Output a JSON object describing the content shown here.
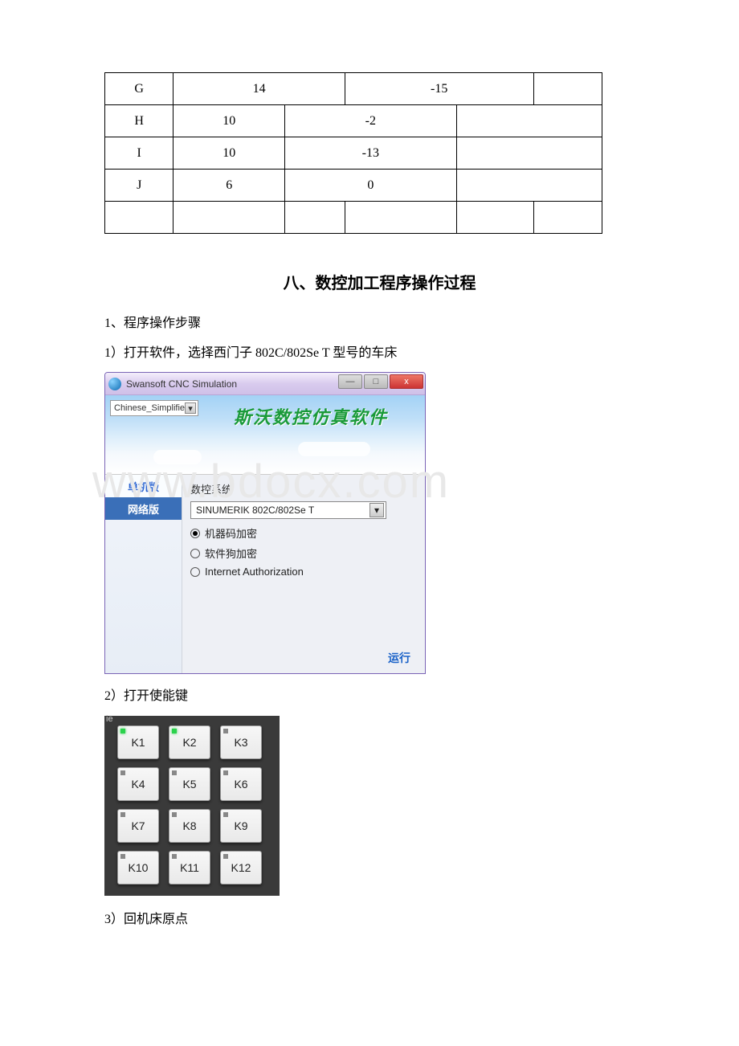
{
  "table": {
    "rows": [
      {
        "c1": "G",
        "c2": "",
        "c3": "14",
        "c4": "",
        "c5": "-15",
        "c6": ""
      },
      {
        "c1": "H",
        "c2": "10",
        "c3": "",
        "c4": "-2",
        "c5": "",
        "c6": ""
      },
      {
        "c1": "I",
        "c2": "10",
        "c3": "",
        "c4": "-13",
        "c5": "",
        "c6": ""
      },
      {
        "c1": "J",
        "c2": "6",
        "c3": "",
        "c4": "0",
        "c5": "",
        "c6": ""
      },
      {
        "c1": "",
        "c2": "",
        "c3": "",
        "c4": "",
        "c5": "",
        "c6": ""
      }
    ]
  },
  "section_title": "八、数控加工程序操作过程",
  "step_heading": "1、程序操作步骤",
  "step1": "1）打开软件，选择西门子 802C/802Se T 型号的车床",
  "step2": "2）打开使能键",
  "step3": "3）回机床原点",
  "watermark": "www.bdocx.com",
  "win1": {
    "title": "Swansoft CNC Simulation",
    "lang_combo": "Chinese_Simplifie",
    "banner_text": "斯沃数控仿真软件",
    "left_tab1": "单机版",
    "left_tab2": "网络版",
    "group_label": "数控系统",
    "dropdown_value": "SINUMERIK 802C/802Se T",
    "radio1": "机器码加密",
    "radio2": "软件狗加密",
    "radio3": "Internet Authorization",
    "run_link": "运行",
    "btn_min": "—",
    "btn_max": "□",
    "btn_close": "x"
  },
  "panel2": {
    "corner": "ie",
    "keys": [
      [
        "K1",
        "K2",
        "K3"
      ],
      [
        "K4",
        "K5",
        "K6"
      ],
      [
        "K7",
        "K8",
        "K9"
      ],
      [
        "K10",
        "K11",
        "K12"
      ]
    ],
    "lit": [
      "K1",
      "K2"
    ]
  }
}
